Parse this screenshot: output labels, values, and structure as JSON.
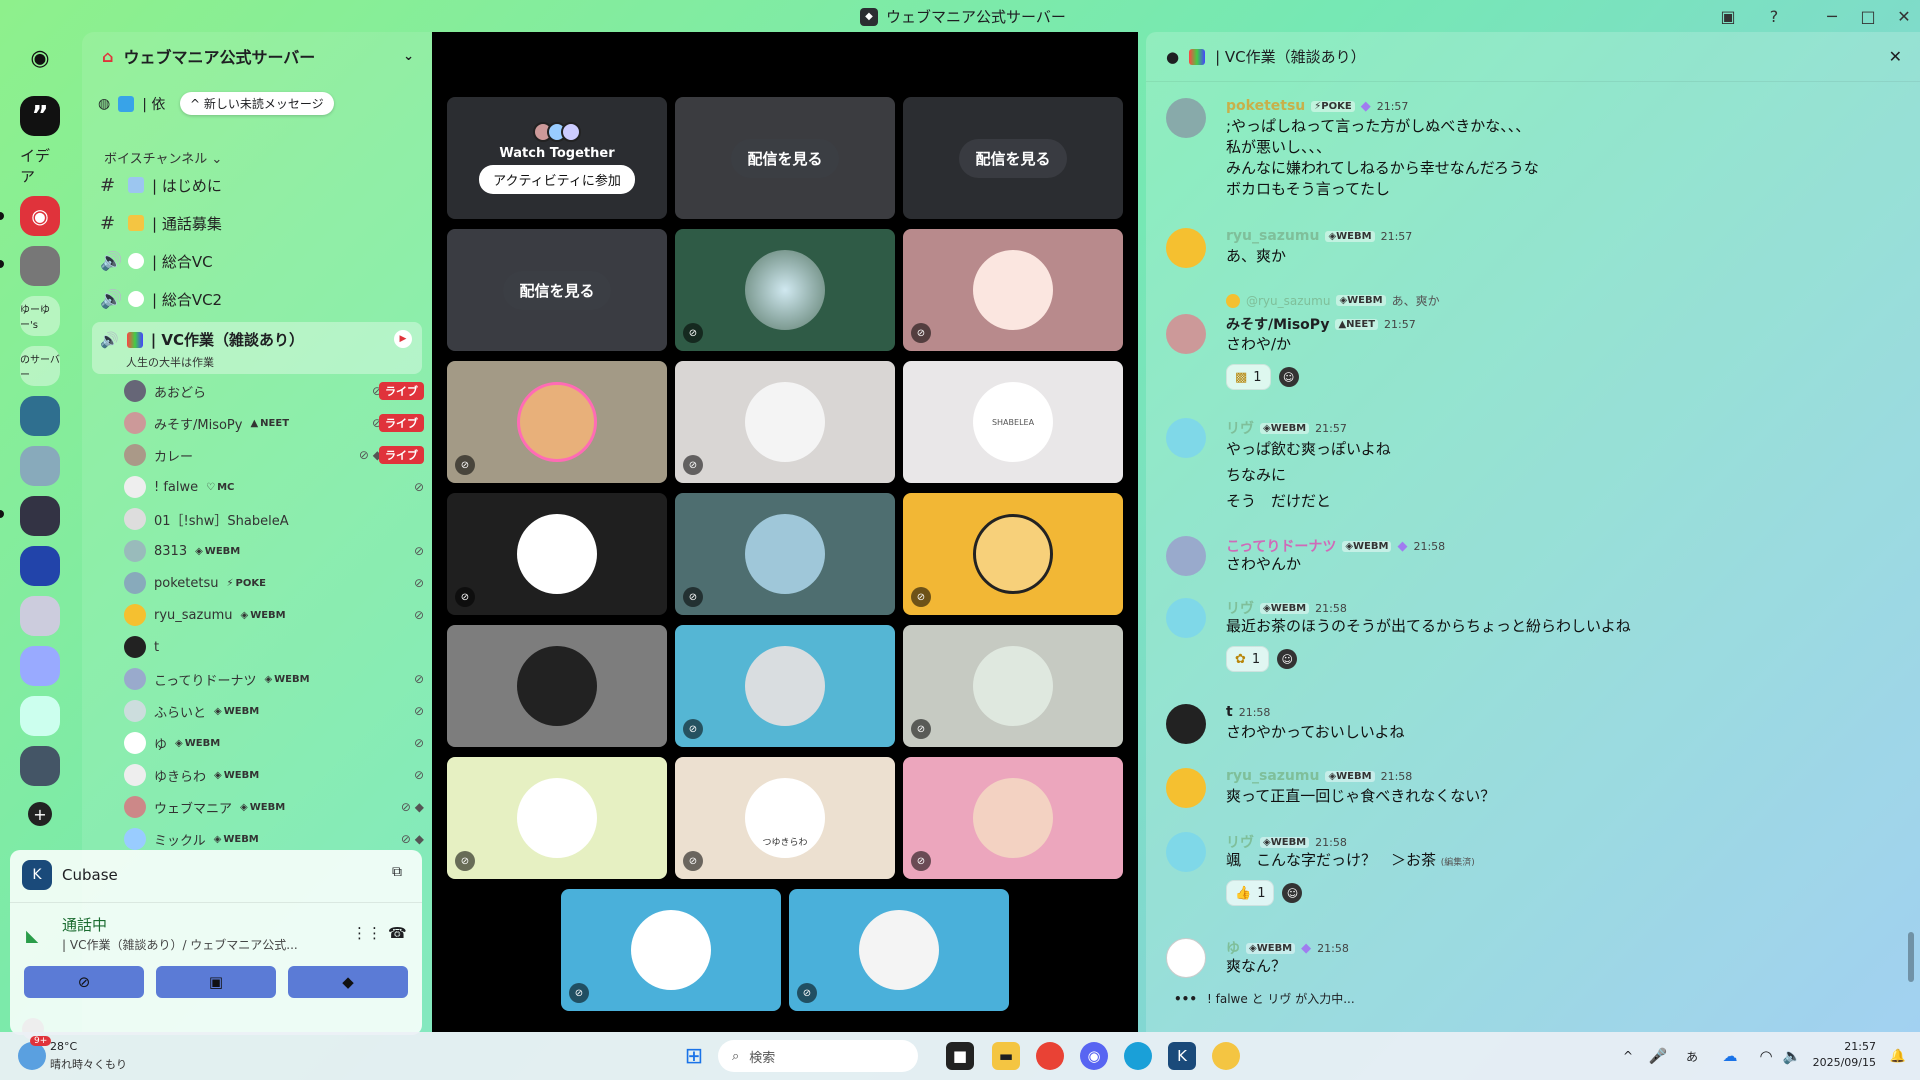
{
  "window": {
    "title": "ウェブマニア公式サーバー"
  },
  "rail": {
    "labels": {
      "idea": "イデア",
      "yuu": "ゆーゆー's",
      "server2": "のサーバー"
    }
  },
  "sidebar": {
    "server_name": "ウェブマニア公式サーバー",
    "new_messages_pill": "^ 新しい未読メッセージ",
    "first_channel": "| 依",
    "voice_category": "ボイスチャンネル",
    "channels": [
      {
        "name": "| はじめに",
        "type": "text"
      },
      {
        "name": "| 通話募集",
        "type": "text"
      },
      {
        "name": "| 総合VC",
        "type": "voice"
      },
      {
        "name": "| 総合VC2",
        "type": "voice"
      }
    ],
    "active_channel": {
      "name": "| VC作業（雑談あり）",
      "subtitle": "人生の大半は作業"
    },
    "users": [
      {
        "name": "あおどら",
        "tag": "",
        "live": "ライブ"
      },
      {
        "name": "みそす/MisoPy",
        "tag": "NEET",
        "live": "ライブ"
      },
      {
        "name": "カレー",
        "tag": "",
        "live": "ライブ"
      },
      {
        "name": "! falwe",
        "tag": "MC",
        "live": ""
      },
      {
        "name": "01［!shw］ShabeleA",
        "tag": "",
        "live": ""
      },
      {
        "name": "8313",
        "tag": "WEBM",
        "live": ""
      },
      {
        "name": "poketetsu",
        "tag": "POKE",
        "live": ""
      },
      {
        "name": "ryu_sazumu",
        "tag": "WEBM",
        "live": ""
      },
      {
        "name": "t",
        "tag": "",
        "live": ""
      },
      {
        "name": "こってりドーナツ",
        "tag": "WEBM",
        "live": ""
      },
      {
        "name": "ふらいと",
        "tag": "WEBM",
        "live": ""
      },
      {
        "name": "ゆ",
        "tag": "WEBM",
        "live": ""
      },
      {
        "name": "ゆきらわ",
        "tag": "WEBM",
        "live": ""
      },
      {
        "name": "ウェブマニア",
        "tag": "WEBM",
        "live": ""
      },
      {
        "name": "ミックル",
        "tag": "WEBM",
        "live": ""
      }
    ]
  },
  "voice_panel": {
    "activity": "Cubase",
    "status": "通話中",
    "location": "| VC作業（雑談あり）/ ウェブマニア公式..."
  },
  "stage": {
    "watch_together": "Watch Together",
    "join_activity": "アクティビティに参加",
    "watch_stream": "配信を見る",
    "shabelea_label": "SHABELEA",
    "tsukira_label": "つゆきらわ"
  },
  "chat": {
    "channel": "| VC作業（雑談あり）",
    "messages": [
      {
        "author": "poketetsu",
        "tag": "POKE",
        "time": "21:57",
        "text": ";やっぱしねって言った方がしぬべきかな、、、\n私が悪いし、、、\nみんなに嫌われてしねるから幸せなんだろうな\nボカロもそう言ってたし"
      },
      {
        "author": "ryu_sazumu",
        "tag": "WEBM",
        "time": "21:57",
        "text": "あ、爽か"
      },
      {
        "author": "みそす/MisoPy",
        "tag": "NEET",
        "time": "21:57",
        "reply": "@ryu_sazumu",
        "reply_tag": "WEBM",
        "reply_text": "あ、爽か",
        "text": "さわや/か",
        "reaction_count": "1"
      },
      {
        "author": "リヴ",
        "tag": "WEBM",
        "time": "21:57",
        "text": "やっぱ飲む爽っぽいよね\nちなみに\nそう　だけだと"
      },
      {
        "author": "こってりドーナツ",
        "tag": "WEBM",
        "time": "21:58",
        "text": "さわやんか"
      },
      {
        "author": "リヴ",
        "tag": "WEBM",
        "time": "21:58",
        "text": "最近お茶のほうのそうが出てるからちょっと紛らわしいよね",
        "reaction_count": "1"
      },
      {
        "author": "t",
        "tag": "",
        "time": "21:58",
        "text": "さわやかっておいしいよね"
      },
      {
        "author": "ryu_sazumu",
        "tag": "WEBM",
        "time": "21:58",
        "text": "爽って正直一回じゃ食べきれなくない？"
      },
      {
        "author": "リヴ",
        "tag": "WEBM",
        "time": "21:58",
        "text": "颯　こんな字だっけ？　＞お茶",
        "edited": "(編集済)",
        "reaction_count": "1"
      },
      {
        "author": "ゆ",
        "tag": "WEBM",
        "time": "21:58",
        "text": "爽なん？"
      }
    ],
    "typing": "! falwe と リヴ が入力中..."
  },
  "taskbar": {
    "weather_temp": "28°C",
    "weather_text": "晴れ時々くもり",
    "weather_badge": "9+",
    "search_placeholder": "検索",
    "time": "21:57",
    "date": "2025/09/15"
  }
}
